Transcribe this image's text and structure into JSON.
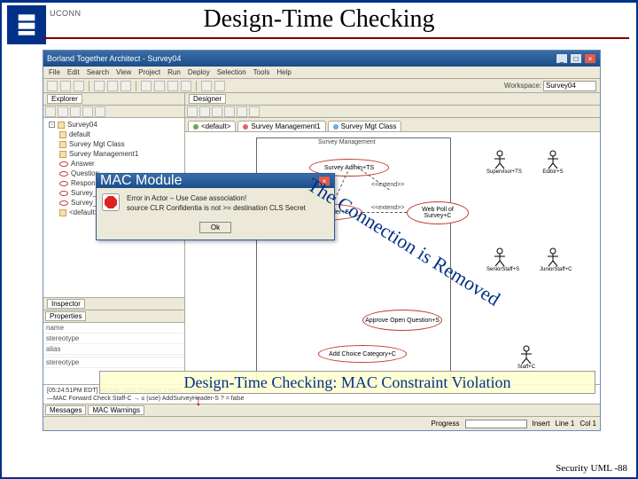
{
  "slide": {
    "title": "Design-Time Checking",
    "footer": "Security UML -88",
    "logo_label": "UCONN"
  },
  "window": {
    "title": "Borland Together Architect - Survey04",
    "menus": [
      "File",
      "Edit",
      "Search",
      "View",
      "Project",
      "Run",
      "Deploy",
      "Selection",
      "Tools",
      "Help"
    ],
    "workspace_label": "Workspace:",
    "workspace_value": "Survey04"
  },
  "explorer": {
    "tab": "Explorer",
    "root": "Survey04",
    "children": [
      "default",
      "Survey Mgt Class",
      "Survey Management1",
      "Answer",
      "Question",
      "Response",
      "Survey_Question",
      "Survey_User_App_Fig",
      "<default>"
    ]
  },
  "inspector": {
    "tab": "Inspector",
    "section": "Properties",
    "rows": [
      {
        "k": "name",
        "v": ""
      },
      {
        "k": "stereotype",
        "v": ""
      },
      {
        "k": "alias",
        "v": ""
      },
      {
        "k": "",
        "v": ""
      },
      {
        "k": "stereotype",
        "v": ""
      }
    ]
  },
  "designer": {
    "tab": "Designer",
    "tabs": [
      {
        "label": "<default>",
        "color": "#6aa84f"
      },
      {
        "label": "Survey Management1",
        "color": "#e06666"
      },
      {
        "label": "Survey Mgt Class",
        "color": "#6fa8dc"
      }
    ]
  },
  "diagram": {
    "pkg": "Survey Management",
    "usecases": {
      "admin": "Survey Admin+TS",
      "add_header": "Add Survey Header+S",
      "web_poll": "Web Poll of Survey+C",
      "approve": "Approve Open Question+S",
      "add_cat": "Add Choice Category+C"
    },
    "extend": "<<extend>>",
    "actors": {
      "supervisor": "Supervisor+TS",
      "editor": "Editor+S",
      "senior": "SeniorStaff+S",
      "junior": "JuniorStaff+C",
      "staff": "Staff+C"
    }
  },
  "dialog": {
    "title": "MAC Module",
    "line1": "Error in Actor – Use Case association!",
    "line2": "source CLR Confidentia is not >= destination CLS Secret",
    "ok": "Ok"
  },
  "annotations": {
    "removed": "The Connection is Removed",
    "banner": "Design-Time Checking: MAC Constraint Violation"
  },
  "messages": {
    "tab": "Messages",
    "tabs": [
      "Messages",
      "MAC Warnings"
    ],
    "line1": "[05:24:51PM EDT] Module: MAC Forward Check: —log output—",
    "line2": "—MAC Forward Check Staff-C → ≤ (use) AddSurveyHeader-S ? = false"
  },
  "status": {
    "progress": "Progress",
    "insert": "Insert",
    "line": "Line 1",
    "col": "Col 1"
  }
}
